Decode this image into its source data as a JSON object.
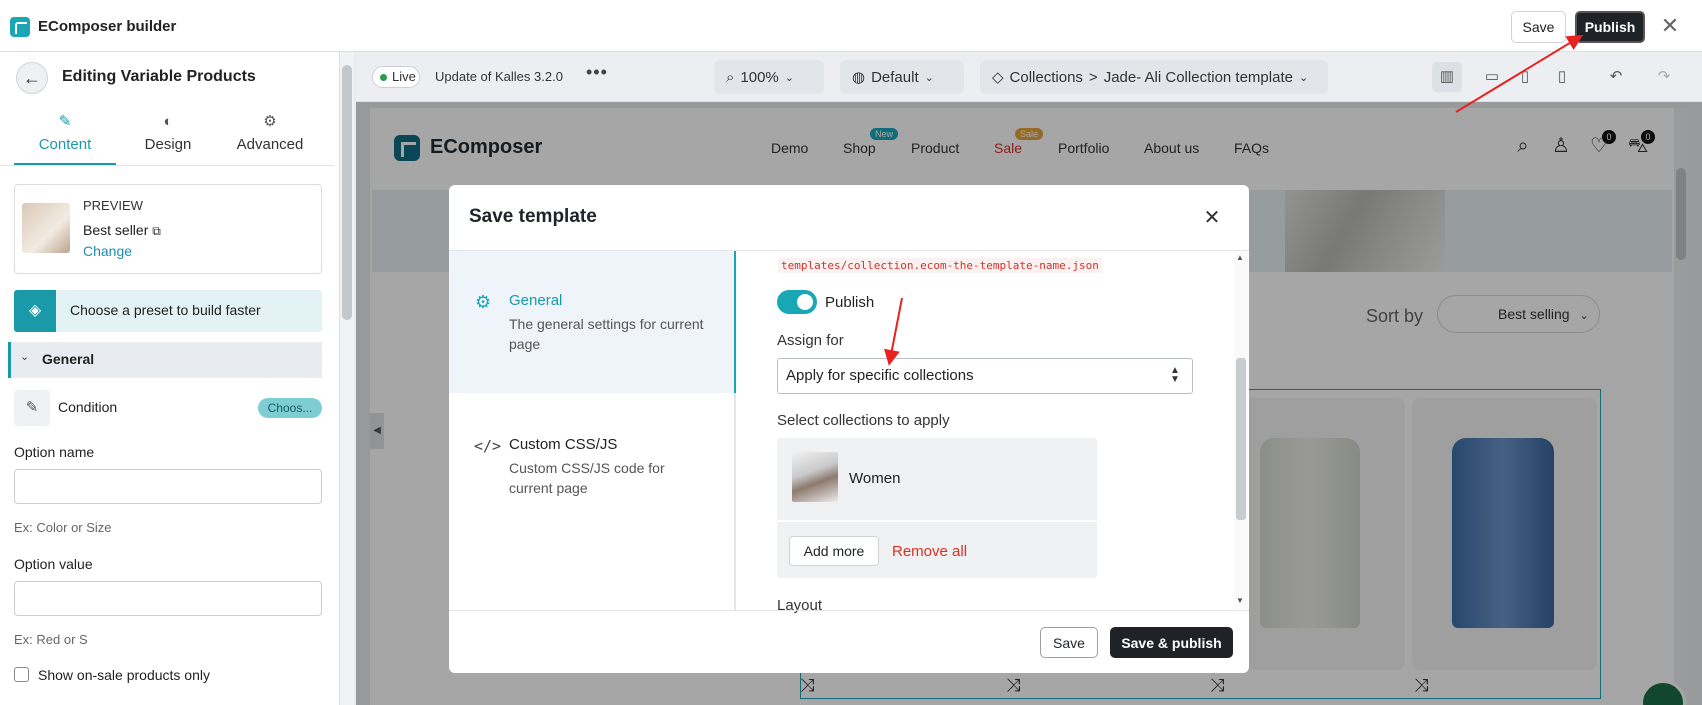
{
  "app": {
    "title": "EComposer builder"
  },
  "topbar": {
    "save_label": "Save",
    "publish_label": "Publish",
    "close_glyph": "✕"
  },
  "left_panel": {
    "title": "Editing Variable Products",
    "tabs": [
      {
        "label": "Content",
        "icon": "pencil-icon",
        "active": true
      },
      {
        "label": "Design",
        "icon": "palette-icon"
      },
      {
        "label": "Advanced",
        "icon": "gear-icon"
      }
    ],
    "preview": {
      "label": "PREVIEW",
      "name": "Best seller",
      "change": "Change"
    },
    "preset": {
      "label": "Choose a preset to build faster"
    },
    "section": {
      "label": "General"
    },
    "condition": {
      "label": "Condition",
      "chip": "Choos..."
    },
    "option_name": {
      "label": "Option name",
      "value": "",
      "hint": "Ex: Color or Size"
    },
    "option_value": {
      "label": "Option value",
      "value": "",
      "hint": "Ex: Red or S"
    },
    "sale_only": {
      "label": "Show on-sale products only",
      "checked": false
    }
  },
  "toolbar": {
    "live": "Live",
    "version": "Update of Kalles 3.2.0",
    "zoom": "100%",
    "view": "Default",
    "breadcrumb_root": "Collections",
    "breadcrumb_separator": ">",
    "breadcrumb_page": "Jade- Ali Collection template"
  },
  "store": {
    "logo": "EComposer",
    "nav": [
      "Demo",
      "Shop",
      "Product",
      "Sale",
      "Portfolio",
      "About us",
      "FAQs"
    ],
    "badges": {
      "shop": "New",
      "sale": "Sale"
    },
    "wishlist_count": "0",
    "cart_count": "0",
    "sort_label": "Sort by",
    "sort_value": "Best selling"
  },
  "modal": {
    "title": "Save template",
    "sidebar": [
      {
        "title": "General",
        "desc": "The general settings for current page",
        "active": true
      },
      {
        "title": "Custom CSS/JS",
        "desc": "Custom CSS/JS code for current page"
      }
    ],
    "template_path": "templates/collection.ecom-the-template-name.json",
    "publish_toggle": {
      "label": "Publish",
      "on": true
    },
    "assign_for": {
      "label": "Assign for",
      "value": "Apply for specific collections"
    },
    "collections": {
      "label": "Select collections to apply",
      "items": [
        {
          "name": "Women"
        }
      ],
      "add_more": "Add more",
      "remove_all": "Remove all"
    },
    "layout_label": "Layout",
    "footer": {
      "save": "Save",
      "save_publish": "Save & publish"
    }
  },
  "colors": {
    "accent": "#1aa7b5",
    "annotation": "#e8231f",
    "danger": "#d93025",
    "dark_button": "#1f2328"
  }
}
